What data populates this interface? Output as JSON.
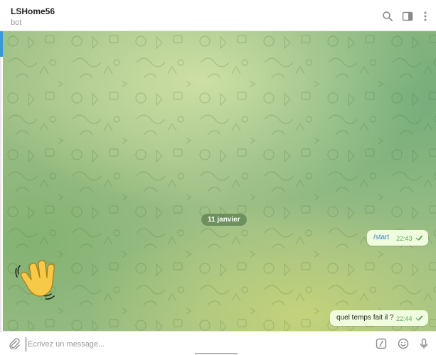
{
  "header": {
    "title": "LSHome56",
    "subtitle": "bot",
    "icons": [
      "search-icon",
      "sidebar-toggle-icon",
      "more-vertical-icon"
    ]
  },
  "chat": {
    "date_label": "11 janvier",
    "messages": [
      {
        "text": "/start",
        "time": "22:43",
        "status": "read",
        "kind": "command"
      },
      {
        "text": "quel temps fait il ?",
        "time": "22:44",
        "status": "read",
        "kind": "text"
      }
    ],
    "sticker": "waving-hand-sticker"
  },
  "composer": {
    "placeholder": "Écrivez un message...",
    "value": "",
    "icons": [
      "attach-icon",
      "bot-command-icon",
      "emoji-icon",
      "microphone-icon"
    ]
  },
  "colors": {
    "bubble": "#effdde",
    "tick": "#5fa862",
    "date_pill": "#5a7d50",
    "accent": "#3b98d6"
  }
}
